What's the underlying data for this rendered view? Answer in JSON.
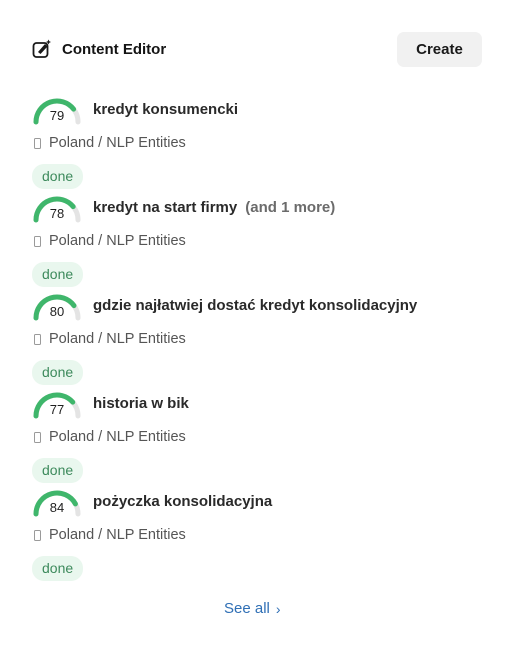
{
  "header": {
    "title": "Content Editor",
    "create_label": "Create",
    "icon": "edit-sparkle-icon"
  },
  "items": [
    {
      "score": 79,
      "score_pct": 79,
      "keyword": "kredyt konsumencki",
      "extra": "",
      "meta": "Poland / NLP Entities",
      "status": "done"
    },
    {
      "score": 78,
      "score_pct": 78,
      "keyword": "kredyt na start firmy",
      "extra": "(and 1 more)",
      "meta": "Poland / NLP Entities",
      "status": "done"
    },
    {
      "score": 80,
      "score_pct": 80,
      "keyword": "gdzie najłatwiej dostać kredyt konsolidacyjny",
      "extra": "",
      "meta": "Poland / NLP Entities",
      "status": "done"
    },
    {
      "score": 77,
      "score_pct": 77,
      "keyword": "historia w bik",
      "extra": "",
      "meta": "Poland / NLP Entities",
      "status": "done"
    },
    {
      "score": 84,
      "score_pct": 84,
      "keyword": "pożyczka konsolidacyjna",
      "extra": "",
      "meta": "Poland / NLP Entities",
      "status": "done"
    }
  ],
  "footer": {
    "see_all_label": "See all",
    "chevron_icon": "chevron-right-icon"
  },
  "colors": {
    "gauge_fill": "#3fb66b",
    "gauge_track": "#e4e4e4",
    "badge_bg": "#e9f7ee",
    "badge_text": "#3d8a5c",
    "link": "#2f6fb5"
  }
}
